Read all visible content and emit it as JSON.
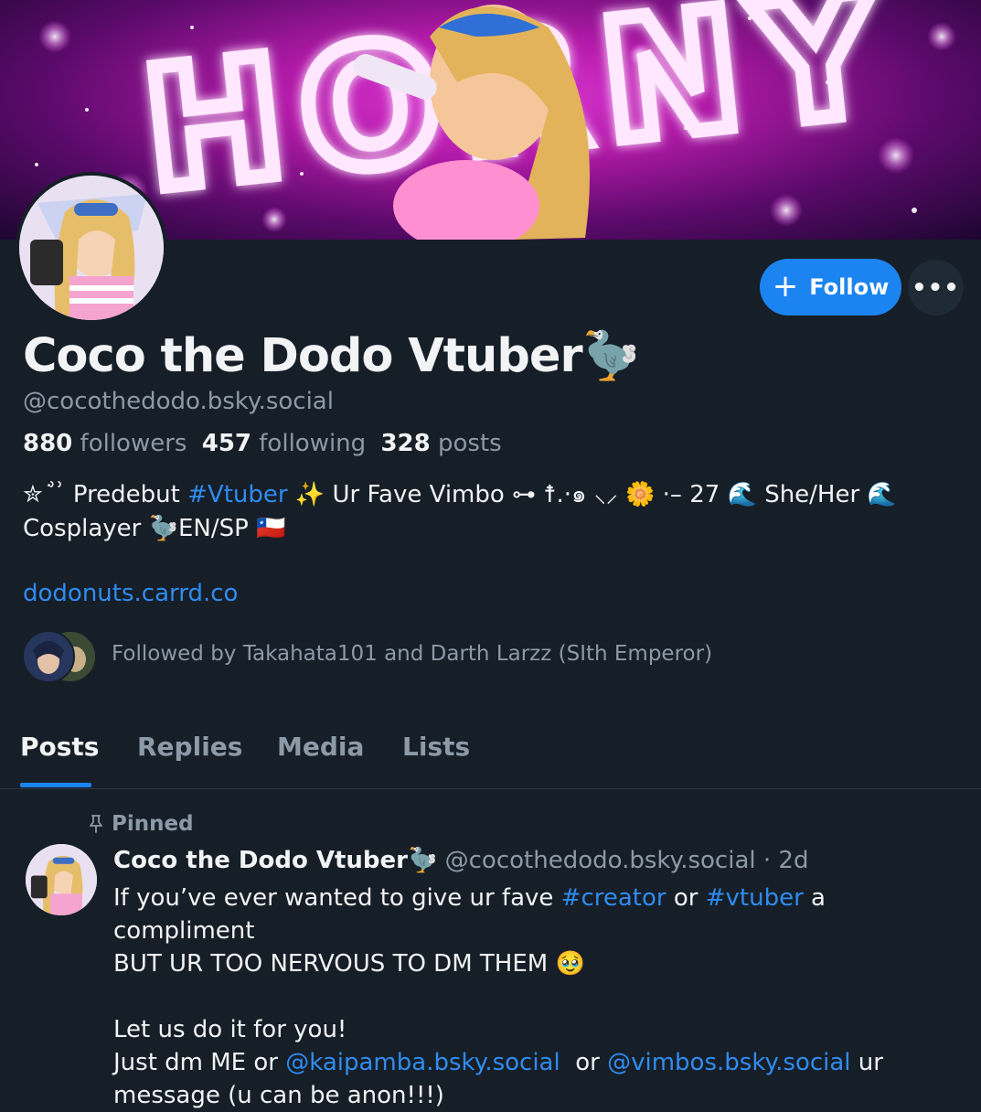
{
  "banner": {
    "text": "HORNY"
  },
  "profile": {
    "display_name": "Coco the Dodo Vtuber🦤",
    "handle": "@cocothedodo.bsky.social",
    "followers_count": "880",
    "followers_label": "followers",
    "following_count": "457",
    "following_label": "following",
    "posts_count": "328",
    "posts_label": "posts",
    "bio_line1_a": "✮ ͘ ͗ ͗ Predebut ",
    "bio_line1_tag": "#Vtuber",
    "bio_line1_b": " ✨ Ur Fave Vimbo ⊶ ☨.·๑ ⸜⸝ 🌼 ·– 27 🌊 She/Her 🌊",
    "bio_line2": "Cosplayer 🦤EN/SP 🇨🇱",
    "link": "dodonuts.carrd.co",
    "followed_by": "Followed by Takahata101 and Darth Larzz (SIth Emperor)"
  },
  "actions": {
    "follow_label": "Follow",
    "follow_icon": "+",
    "more_icon": "•••"
  },
  "tabs": [
    {
      "label": "Posts",
      "active": true
    },
    {
      "label": "Replies",
      "active": false
    },
    {
      "label": "Media",
      "active": false
    },
    {
      "label": "Lists",
      "active": false
    }
  ],
  "post": {
    "pinned_label": "Pinned",
    "author_name": "Coco the Dodo Vtuber🦤",
    "author_handle": "@cocothedodo.bsky.social",
    "time": "· 2d",
    "line1_a": "If you’ve ever wanted to give ur fave ",
    "line1_tag1": "#creator",
    "line1_b": " or ",
    "line1_tag2": "#vtuber",
    "line1_c": " a compliment",
    "line2": "BUT UR TOO NERVOUS TO DM THEM 🥹",
    "line3": "Let us do it for you!",
    "line4_a": "Just dm ME or ",
    "line4_mention1": "@kaipamba.bsky.social",
    "line4_b": "  or ",
    "line4_mention2": "@vimbos.bsky.social",
    "line4_c": " ur",
    "line5": "message (u can be anon!!!)"
  },
  "colors": {
    "background": "#161e27",
    "accent": "#1c84f0",
    "link": "#2f8cf0",
    "muted": "#8c9aa8"
  }
}
